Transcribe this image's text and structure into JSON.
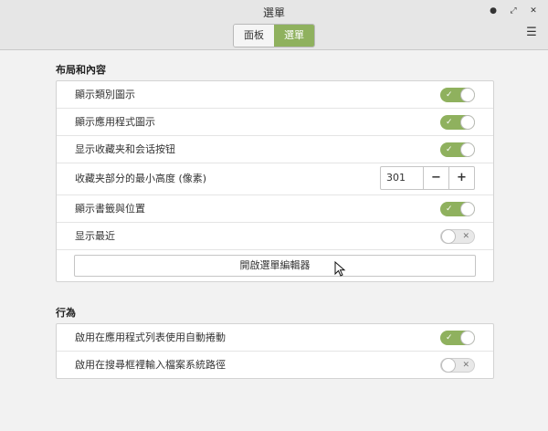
{
  "window": {
    "title": "選單",
    "controls": [
      "minimize",
      "restore",
      "close"
    ]
  },
  "tabs": [
    {
      "label": "面板",
      "active": false
    },
    {
      "label": "選單",
      "active": true
    }
  ],
  "sections": {
    "layout": {
      "title": "布局和內容",
      "rows": [
        {
          "label": "顯示類別圖示",
          "state": "on"
        },
        {
          "label": "顯示應用程式圖示",
          "state": "on"
        },
        {
          "label": "显示收藏夹和会话按钮",
          "state": "on"
        },
        {
          "label": "收藏夹部分的最小高度 (像素)",
          "value": "301"
        },
        {
          "label": "顯示書籤與位置",
          "state": "on"
        },
        {
          "label": "显示最近",
          "state": "off"
        }
      ],
      "editor_button": "開啟選單編輯器"
    },
    "behavior": {
      "title": "行為",
      "rows": [
        {
          "label": "啟用在應用程式列表使用自動捲動",
          "state": "on"
        },
        {
          "label": "啟用在搜尋框裡輸入檔案系統路徑",
          "state": "off"
        }
      ]
    }
  },
  "colors": {
    "accent": "#8fb15e"
  },
  "icons": {
    "on_mark": "✓",
    "off_mark": "✕",
    "menu": "☰"
  }
}
